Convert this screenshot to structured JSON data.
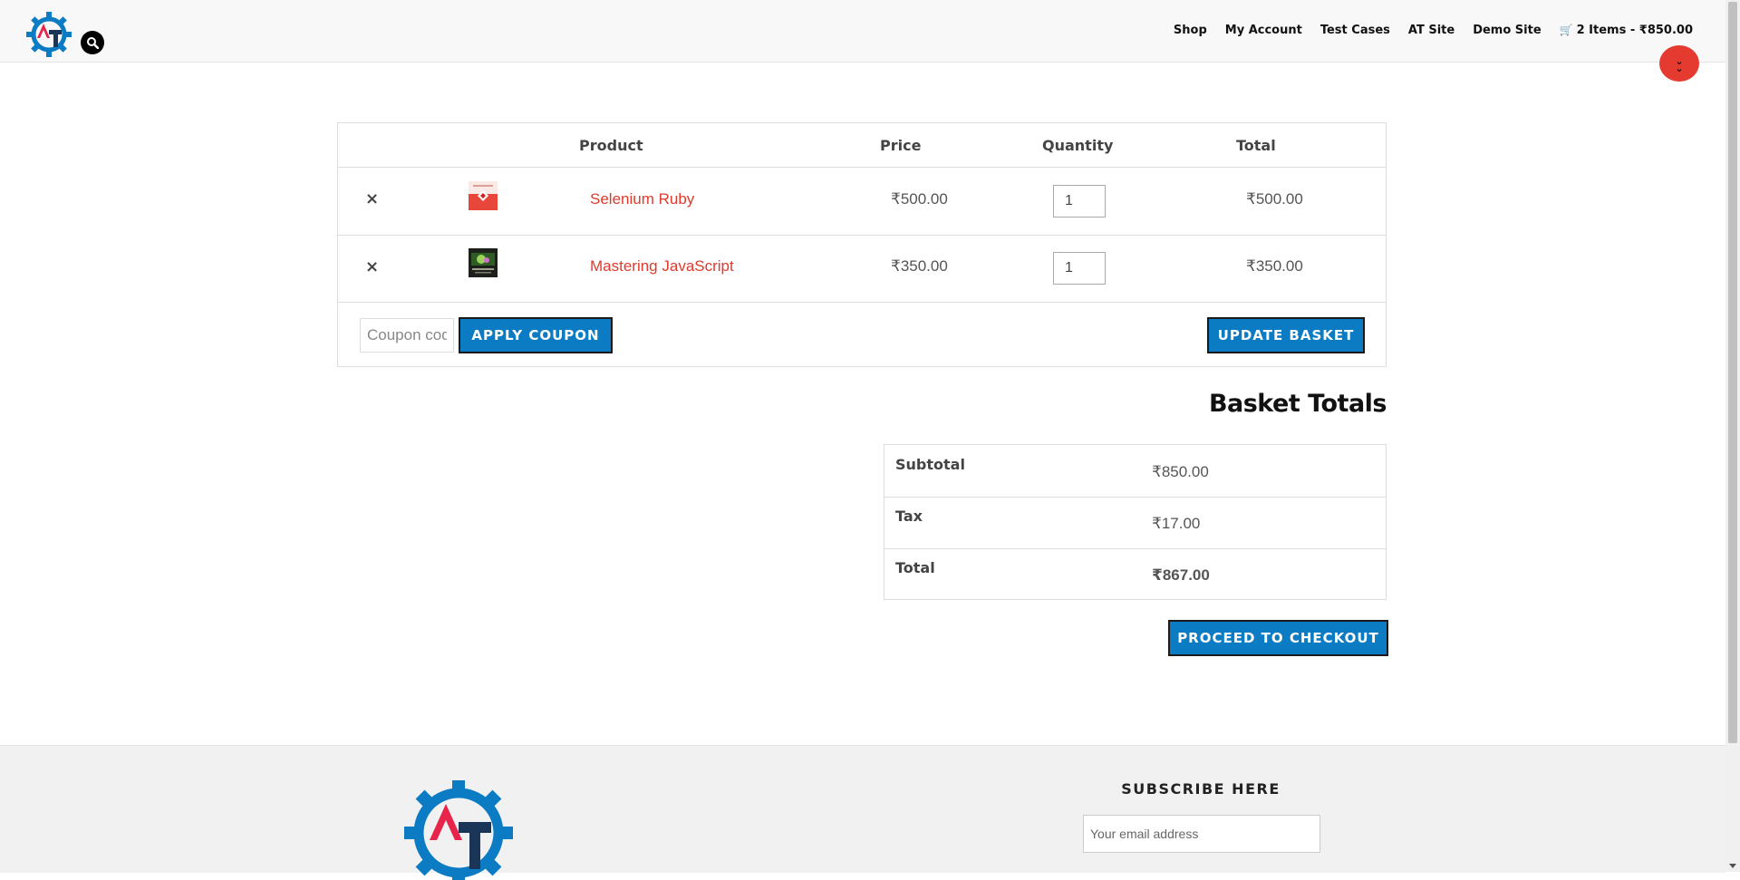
{
  "header": {
    "nav": [
      "Shop",
      "My Account",
      "Test Cases",
      "AT Site",
      "Demo Site"
    ],
    "cart_summary": "2 Items - ₹850.00"
  },
  "cart": {
    "columns": {
      "product": "Product",
      "price": "Price",
      "quantity": "Quantity",
      "total": "Total"
    },
    "remove_glyph": "×",
    "items": [
      {
        "name": "Selenium Ruby",
        "price": "₹500.00",
        "quantity": "1",
        "total": "₹500.00"
      },
      {
        "name": "Mastering JavaScript",
        "price": "₹350.00",
        "quantity": "1",
        "total": "₹350.00"
      }
    ],
    "coupon_placeholder": "Coupon code",
    "apply_coupon_label": "APPLY COUPON",
    "update_basket_label": "UPDATE BASKET"
  },
  "totals": {
    "title": "Basket Totals",
    "rows": [
      {
        "label": "Subtotal",
        "value": "₹850.00"
      },
      {
        "label": "Tax",
        "value": "₹17.00"
      },
      {
        "label": "Total",
        "value": "₹867.00"
      }
    ],
    "checkout_label": "PROCEED TO CHECKOUT"
  },
  "footer": {
    "subscribe_title": "SUBSCRIBE HERE",
    "email_placeholder": "Your email address"
  },
  "colors": {
    "accent_blue": "#0b7bc3",
    "link_red": "#e03a2d",
    "logo_red": "#e8244a",
    "logo_navy": "#1b3558"
  },
  "icons": [
    "site-logo-icon",
    "search-icon",
    "cart-icon",
    "scroll-top-icon",
    "remove-icon"
  ]
}
